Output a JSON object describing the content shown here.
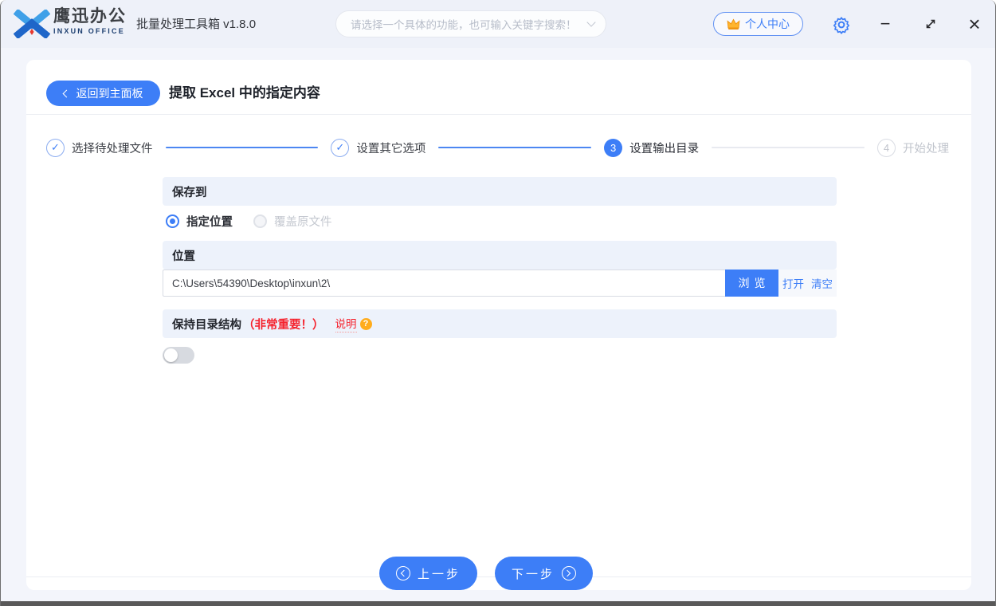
{
  "colors": {
    "accent": "#3d7ef7",
    "danger": "#f5222d",
    "warning": "#ffac1c",
    "titlebar_bg": "#eef1f9",
    "section_bg": "#edf2fb"
  },
  "titlebar": {
    "brand_cn": "鹰迅办公",
    "brand_en": "INXUN OFFICE",
    "app_title": "批量处理工具箱 v1.8.0",
    "search_placeholder": "请选择一个具体的功能，也可输入关键字搜索！",
    "account_label": "个人中心",
    "minimize_glyph": "−",
    "close_glyph": "×"
  },
  "page": {
    "back_label": "返回到主面板",
    "title": "提取 Excel 中的指定内容",
    "check_glyph": "✓",
    "steps": [
      {
        "label": "选择待处理文件",
        "state": "done"
      },
      {
        "label": "设置其它选项",
        "state": "done"
      },
      {
        "label": "设置输出目录",
        "state": "active",
        "number": "3"
      },
      {
        "label": "开始处理",
        "state": "pending",
        "number": "4"
      }
    ],
    "form": {
      "save_to": {
        "title": "保存到",
        "options": [
          {
            "label": "指定位置",
            "selected": true
          },
          {
            "label": "覆盖原文件",
            "selected": false,
            "disabled": true
          }
        ]
      },
      "location": {
        "title": "位置",
        "path": "C:\\Users\\54390\\Desktop\\inxun\\2\\",
        "browse_label": "浏览",
        "open_label": "打开",
        "clear_label": "清空"
      },
      "keep_structure": {
        "title": "保持目录结构",
        "important_note": "（非常重要！）",
        "help_label": "说明",
        "help_badge": "?",
        "enabled": false
      }
    },
    "footer": {
      "prev_label": "上一步",
      "next_label": "下一步"
    }
  }
}
